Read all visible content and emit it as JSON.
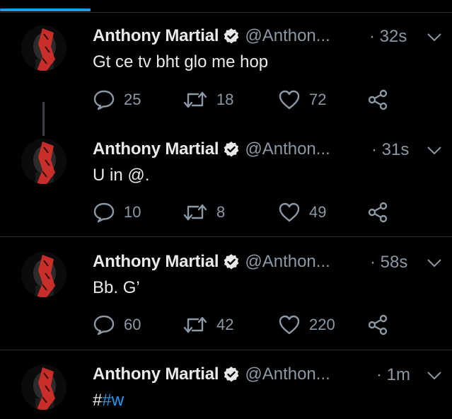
{
  "icons": {
    "reply": "reply-icon",
    "retweet": "retweet-icon",
    "like": "heart-icon",
    "share": "share-icon",
    "verified": "verified-badge-icon",
    "caret": "chevron-down-icon"
  },
  "colors": {
    "background": "#000000",
    "accent": "#1d9bf0",
    "secondary_text": "#8b98a5",
    "avatar_red": "#d6302b"
  },
  "tweets": [
    {
      "name": "Anthony Martial",
      "handle": "@Anthon...",
      "time": "· 32s",
      "text": "Gt ce tv bht glo me hop",
      "replies": "25",
      "retweets": "18",
      "likes": "72"
    },
    {
      "name": "Anthony Martial",
      "handle": "@Anthon...",
      "time": "· 31s",
      "text": "U in @.",
      "replies": "10",
      "retweets": "8",
      "likes": "49"
    },
    {
      "name": "Anthony Martial",
      "handle": "@Anthon...",
      "time": "· 58s",
      "text": "Bb. G’",
      "replies": "60",
      "retweets": "42",
      "likes": "220"
    },
    {
      "name": "Anthony Martial",
      "handle": "@Anthon...",
      "time": "· 1m",
      "text_prefix": "#",
      "text_hashtag": "#w"
    }
  ]
}
